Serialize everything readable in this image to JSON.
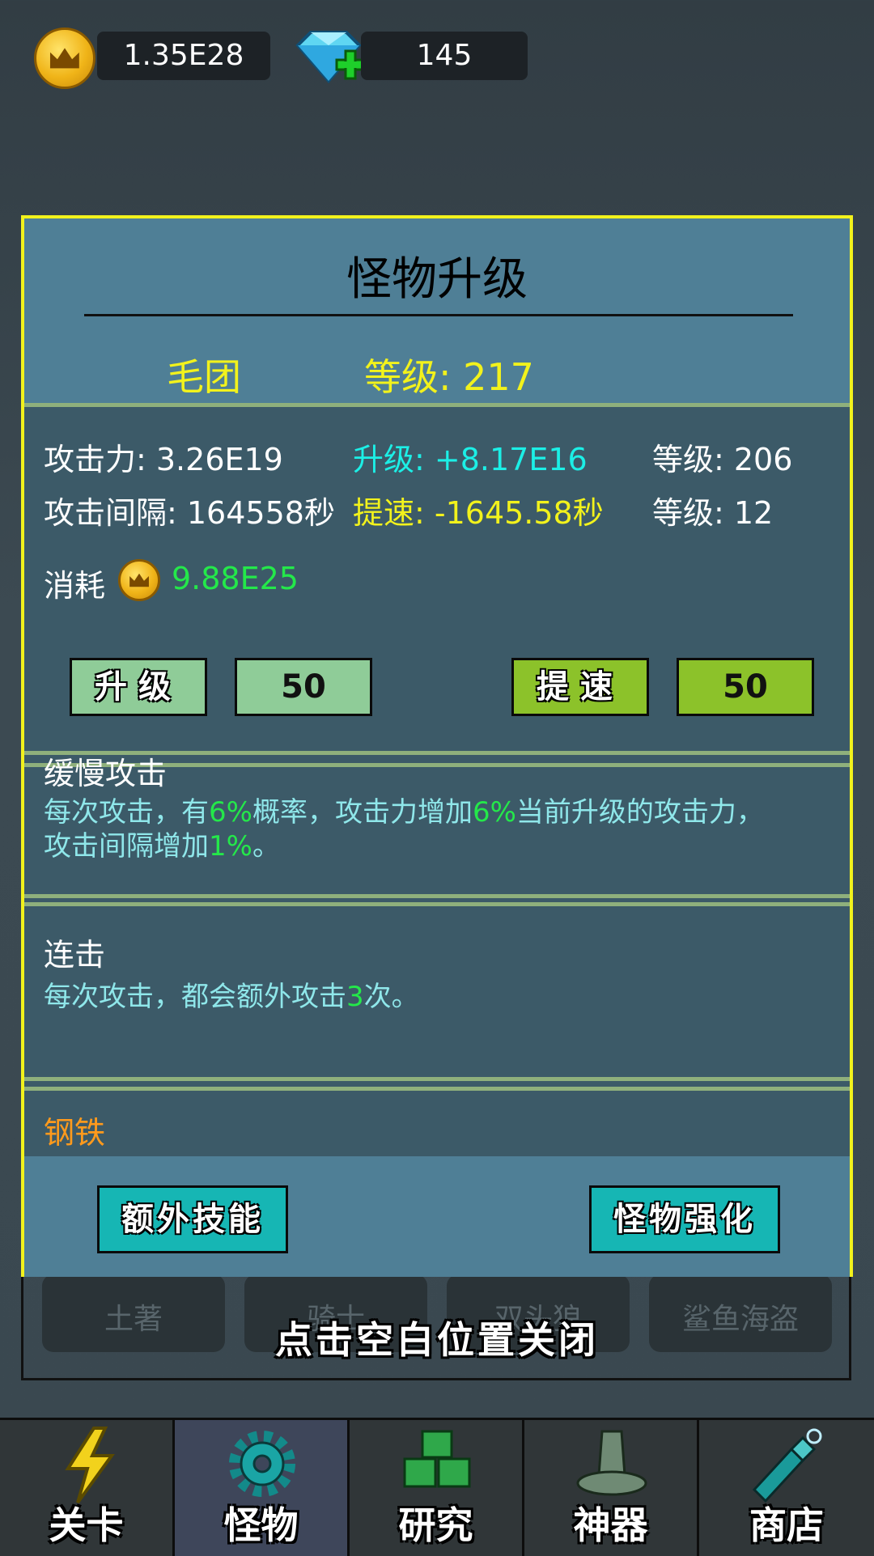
{
  "currency": {
    "gold": {
      "value": "1.35E28",
      "icon": "gold-coin-icon"
    },
    "diamond": {
      "value": "145",
      "icon": "diamond-plus-icon"
    }
  },
  "dialog": {
    "title": "怪物升级",
    "monster_name": "毛团",
    "level_text": "等级: 217",
    "stats": {
      "attack": "攻击力: 3.26E19",
      "upgrade_gain": "升级: +8.17E16",
      "attack_level": "等级: 206",
      "interval": "攻击间隔: 164558秒",
      "speed_gain": "提速: -1645.58秒",
      "speed_level": "等级: 12"
    },
    "cost_label": "消耗",
    "cost_value": "9.88E25",
    "buttons": {
      "upgrade": "升级",
      "upgrade_qty": "50",
      "speed": "提速",
      "speed_qty": "50"
    },
    "skills": [
      {
        "title": "缓慢攻击",
        "desc_a": "每次攻击，有",
        "pct1": "6%",
        "desc_b": "概率，攻击力增加",
        "pct2": "6%",
        "desc_c": "当前升级的攻击力，",
        "desc_d": "攻击间隔增加",
        "pct3": "1%",
        "desc_e": "。"
      },
      {
        "title": "连击",
        "desc_a": "每次攻击，都会额外攻击",
        "num": "3",
        "desc_b": "次。"
      },
      {
        "title": "钢铁"
      }
    ],
    "footer": {
      "extra_skill": "额外技能",
      "enhance": "怪物强化"
    }
  },
  "background_list": [
    "土著",
    "骑士",
    "双头狼",
    "鲨鱼海盗"
  ],
  "close_hint": "点击空白位置关闭",
  "nav": [
    {
      "label": "关卡",
      "icon": "lightning-icon"
    },
    {
      "label": "怪物",
      "icon": "gear-icon"
    },
    {
      "label": "研究",
      "icon": "blocks-icon"
    },
    {
      "label": "神器",
      "icon": "bell-icon"
    },
    {
      "label": "商店",
      "icon": "bottle-icon"
    }
  ],
  "colors": {
    "dialog_border": "#f2f21c",
    "accent_green": "#24e84a",
    "accent_cyan": "#1cefe6",
    "skill_text": "#8fe7ea",
    "skill_orange": "#ff9a1c"
  }
}
